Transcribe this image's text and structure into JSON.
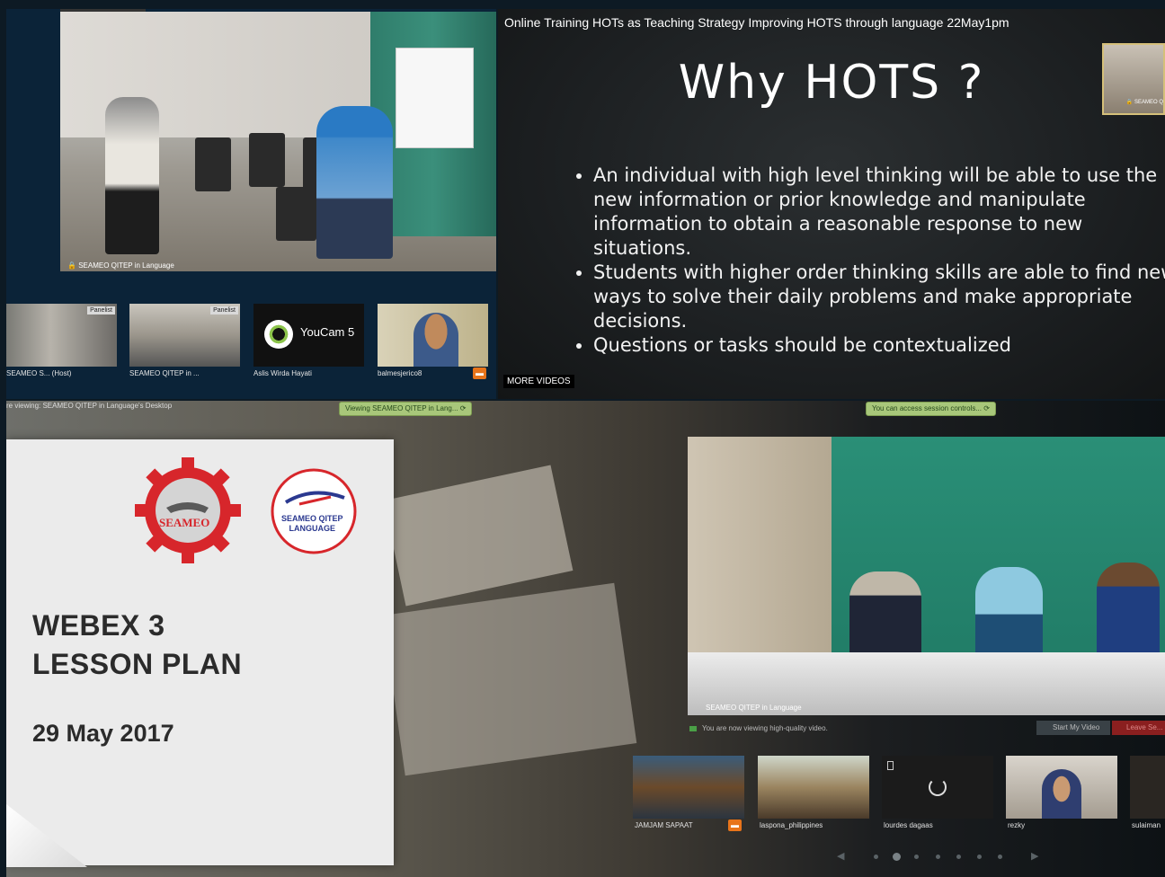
{
  "top_left": {
    "main_video_label": "SEAMEO QITEP in Language",
    "thumbnails": [
      {
        "badge": "Panelist",
        "name": "SEAMEO S...  (Host)"
      },
      {
        "badge": "Panelist",
        "name": "SEAMEO QITEP in ..."
      },
      {
        "badge": "",
        "name": "Aslis Wirda Hayati",
        "logo_text": "YouCam 5"
      },
      {
        "badge": "",
        "name": "balmesjerico8"
      }
    ]
  },
  "top_right": {
    "video_title": "Online Training HOTs as Teaching Strategy Improving HOTS through language 22May1pm",
    "slide_title": "Why HOTS ?",
    "bullets": [
      "An individual with high level thinking will be able to use the new information or prior knowledge and manipulate information to obtain a reasonable response to new situations.",
      "Students with higher order thinking skills are able to find new ways to solve their daily problems and make appropriate decisions.",
      "Questions or tasks should be contextualized"
    ],
    "more_videos": "MORE VIDEOS",
    "pip_label": "SEAMEO Q"
  },
  "bottom": {
    "viewing_text": "re viewing: SEAMEO QITEP in Language's Desktop",
    "viewing_pill": "Viewing SEAMEO QITEP in Lang...",
    "session_pill": "You can access session controls...",
    "card": {
      "seameo_logo": "SEAMEO",
      "qitep_logo_line1": "SEAMEO QITEP",
      "qitep_logo_line2": "LANGUAGE",
      "title_line1": "WEBEX 3",
      "title_line2": "LESSON PLAN",
      "date": "29 May 2017"
    },
    "main_video_label": "SEAMEO QITEP in Language",
    "hq_text": "You are now viewing high-quality video.",
    "start_video": "Start My Video",
    "leave": "Leave Se...",
    "thumbnails": [
      {
        "name": "JAMJAM SAPAAT"
      },
      {
        "name": "laspona_philippines"
      },
      {
        "name": "lourdes dagaas"
      },
      {
        "name": "rezky"
      },
      {
        "name": "sulaiman"
      }
    ]
  },
  "colors": {
    "seameo_red": "#d7262b",
    "qitep_blue": "#2b3990",
    "pill_green": "#a8c77a",
    "chat_orange": "#e8741a"
  }
}
